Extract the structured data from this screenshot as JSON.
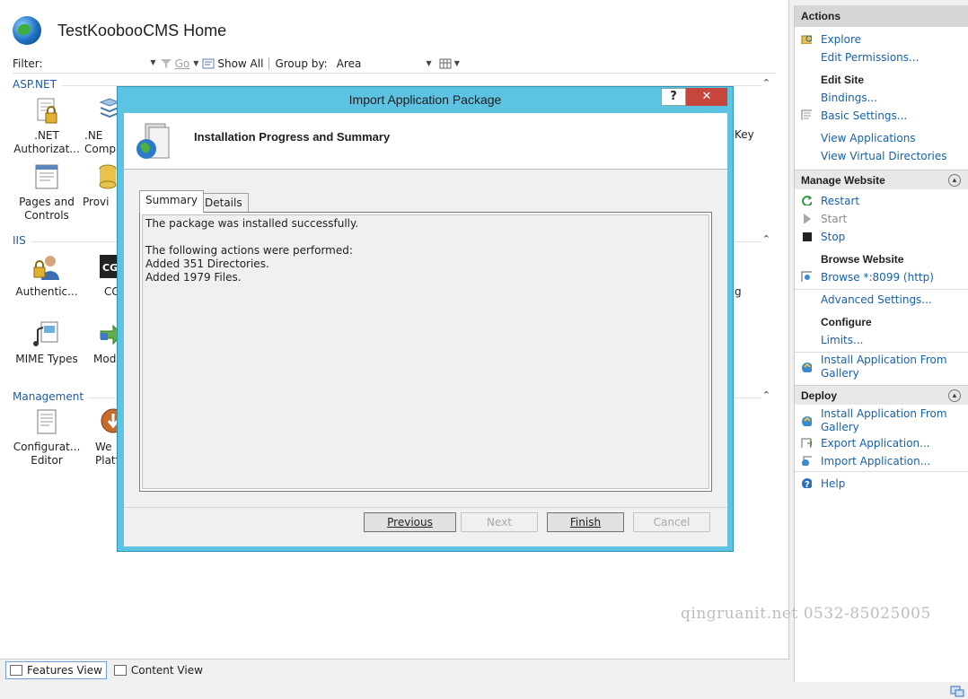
{
  "page": {
    "title": "TestKoobooCMS Home"
  },
  "toolbar": {
    "filter_label": "Filter:",
    "go_label": "Go",
    "show_all_label": "Show All",
    "group_by_label": "Group by:",
    "group_by_value": "Area"
  },
  "groups": {
    "aspnet": "ASP.NET",
    "iis": "IIS",
    "management": "Management"
  },
  "features": {
    "net_authorization": ".NET\nAuthorizat...",
    "net_compilation": ".NE\nCompi",
    "pages_controls": "Pages and\nControls",
    "providers": "Provi",
    "authentication": "Authentic...",
    "cgi": "CG",
    "mime_types": "MIME Types",
    "modules": "Mod",
    "config_editor": "Configurat...\nEditor",
    "web_platform": "We\nPlatf",
    "right_stub_1": "Key",
    "right_stub_2": "g"
  },
  "bottom": {
    "features_view": "Features View",
    "content_view": "Content View"
  },
  "actions": {
    "title": "Actions",
    "explore": "Explore",
    "edit_permissions": "Edit Permissions...",
    "edit_site": "Edit Site",
    "bindings": "Bindings...",
    "basic_settings": "Basic Settings...",
    "view_applications": "View Applications",
    "view_virtual_directories": "View Virtual Directories",
    "manage_website": "Manage Website",
    "restart": "Restart",
    "start": "Start",
    "stop": "Stop",
    "browse_website": "Browse Website",
    "browse_8099": "Browse *:8099 (http)",
    "advanced_settings": "Advanced Settings...",
    "configure": "Configure",
    "limits": "Limits...",
    "install_gallery_1": "Install Application From Gallery",
    "deploy": "Deploy",
    "install_gallery_2": "Install Application From Gallery",
    "export_application": "Export Application...",
    "import_application": "Import Application...",
    "help": "Help"
  },
  "dialog": {
    "title": "Import Application Package",
    "help_glyph": "?",
    "close_glyph": "✕",
    "heading": "Installation Progress and Summary",
    "tab_summary": "Summary",
    "tab_details": "Details",
    "summary_lines": [
      "The package was installed successfully.",
      "",
      "The following actions were performed:",
      "Added 351 Directories.",
      "Added 1979 Files."
    ],
    "btn_previous": "Previous",
    "btn_next": "Next",
    "btn_finish": "Finish",
    "btn_cancel": "Cancel"
  },
  "watermark": "qingruanit.net 0532-85025005",
  "icons": {
    "globe": "globe-icon",
    "filter": "filter-icon",
    "show_all": "show-all-icon",
    "view_toggle": "view-grid-icon",
    "package": "package-icon"
  },
  "colors": {
    "link": "#1560b0",
    "dialog_frame": "#5dc3e3",
    "close_button": "#c7463c",
    "group_header": "#1e5aa8"
  }
}
